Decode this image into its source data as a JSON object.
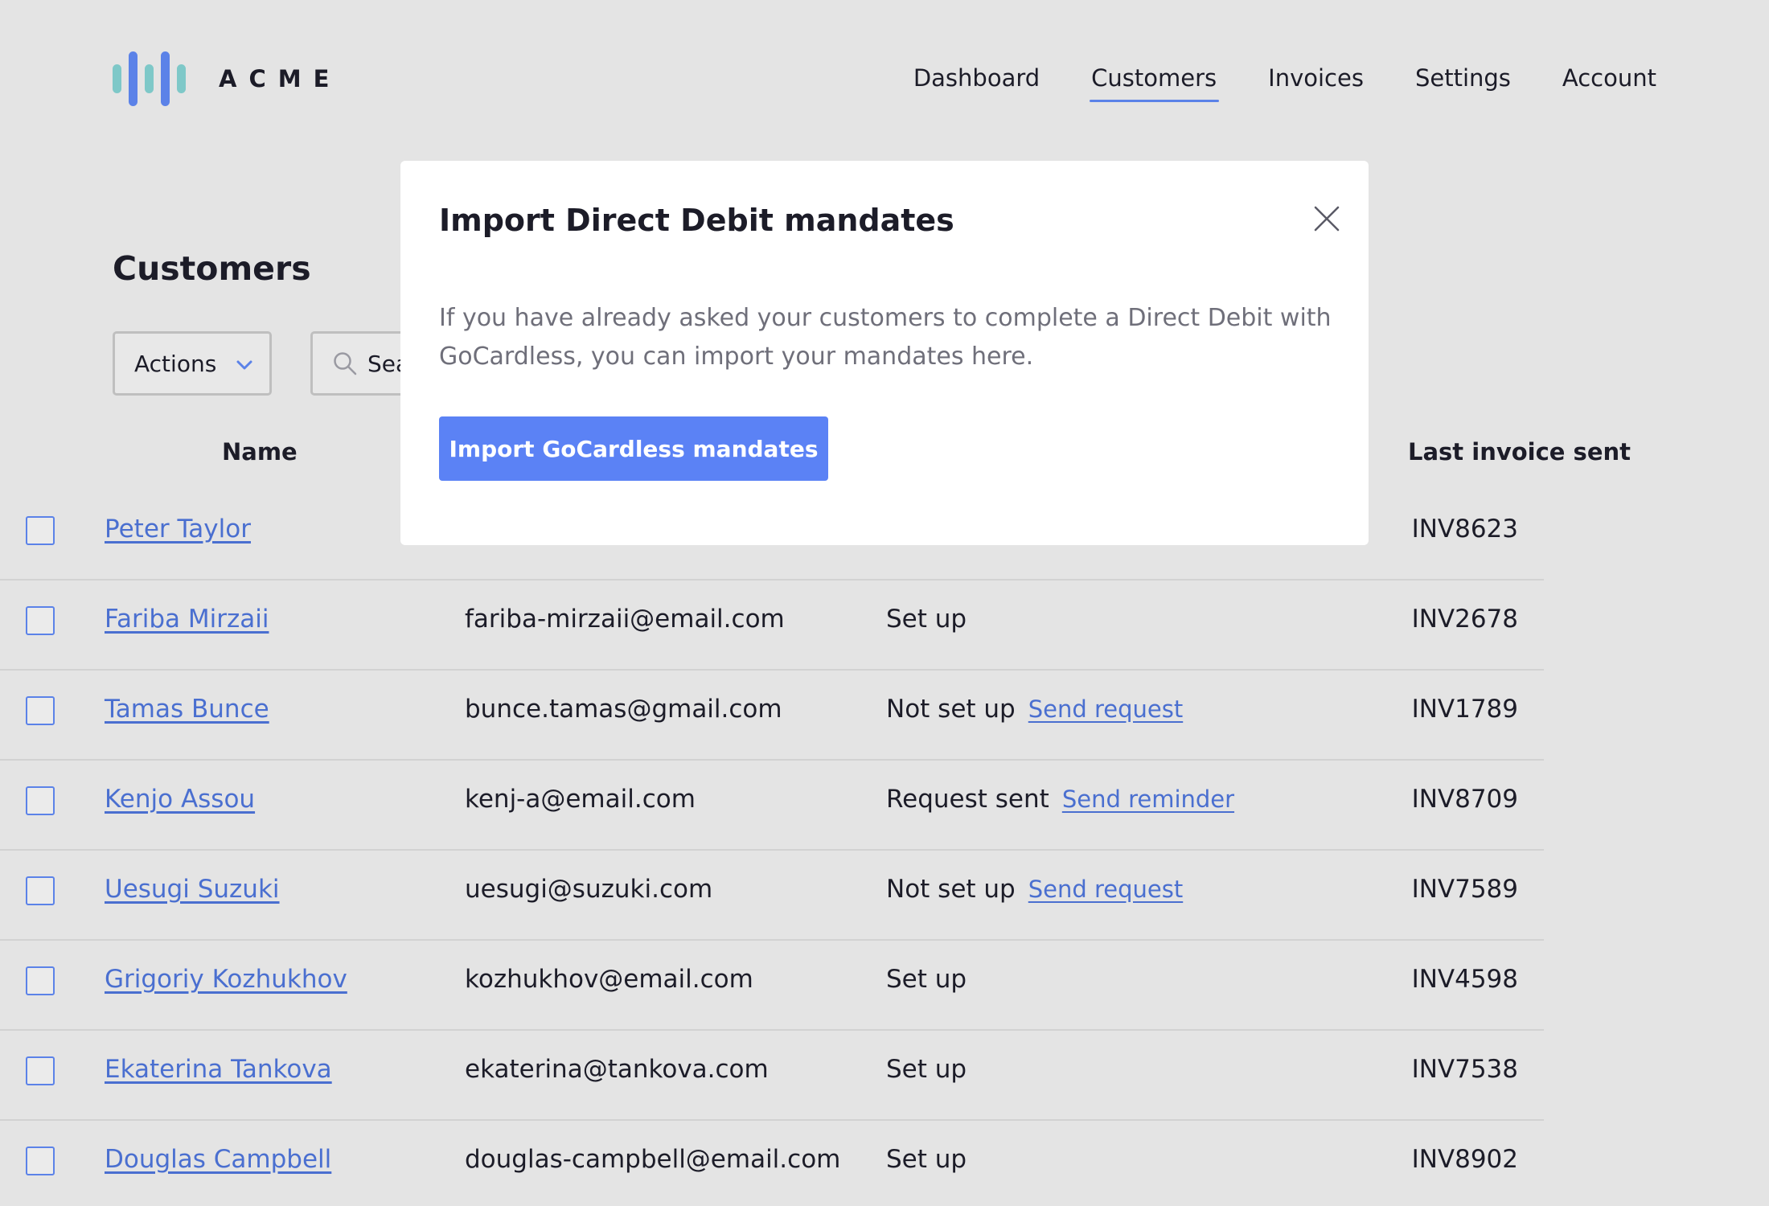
{
  "header": {
    "logo_text": "ACME",
    "nav": [
      {
        "label": "Dashboard",
        "active": false
      },
      {
        "label": "Customers",
        "active": true
      },
      {
        "label": "Invoices",
        "active": false
      },
      {
        "label": "Settings",
        "active": false
      },
      {
        "label": "Account",
        "active": false
      }
    ]
  },
  "page": {
    "title": "Customers",
    "actions_label": "Actions",
    "search_placeholder": "Search"
  },
  "table": {
    "columns": [
      "Name",
      "Last invoice sent"
    ],
    "rows": [
      {
        "name": "Peter Taylor",
        "email": "",
        "status": "",
        "status_link": "",
        "invoice": "INV8623"
      },
      {
        "name": "Fariba Mirzaii",
        "email": "fariba-mirzaii@email.com",
        "status": "Set up",
        "status_link": "",
        "invoice": "INV2678"
      },
      {
        "name": "Tamas Bunce",
        "email": "bunce.tamas@gmail.com",
        "status": "Not set up",
        "status_link": "Send request",
        "invoice": "INV1789"
      },
      {
        "name": "Kenjo Assou",
        "email": "kenj-a@email.com",
        "status": "Request sent",
        "status_link": "Send reminder",
        "invoice": "INV8709"
      },
      {
        "name": "Uesugi Suzuki",
        "email": "uesugi@suzuki.com",
        "status": "Not set up",
        "status_link": "Send request",
        "invoice": "INV7589"
      },
      {
        "name": "Grigoriy Kozhukhov",
        "email": "kozhukhov@email.com",
        "status": "Set up",
        "status_link": "",
        "invoice": "INV4598"
      },
      {
        "name": "Ekaterina Tankova",
        "email": "ekaterina@tankova.com",
        "status": "Set up",
        "status_link": "",
        "invoice": "INV7538"
      },
      {
        "name": "Douglas Campbell",
        "email": "douglas-campbell@email.com",
        "status": "Set up",
        "status_link": "",
        "invoice": "INV8902"
      }
    ]
  },
  "modal": {
    "title": "Import Direct Debit mandates",
    "body": "If you have already asked your customers to complete a Direct Debit with GoCardless, you can import your mandates here.",
    "button_label": "Import GoCardless mandates"
  },
  "colors": {
    "accent": "#5b82e8",
    "link": "#4a6fd0",
    "button": "#5b82f5",
    "logo_teal": "#7ec8c8",
    "logo_blue": "#5b82e8"
  },
  "icons": {
    "logo": "acme-bars-icon",
    "search": "search-icon",
    "dropdown": "chevron-down-icon",
    "close": "close-icon"
  }
}
